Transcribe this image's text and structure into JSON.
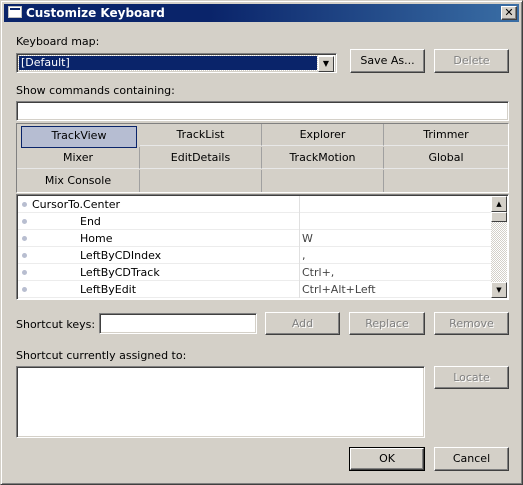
{
  "window": {
    "title": "Customize Keyboard",
    "close": "✕"
  },
  "keyboard_map": {
    "label": "Keyboard map:",
    "value": "[Default]",
    "save_as": "Save As...",
    "delete": "Delete"
  },
  "filter": {
    "label": "Show commands containing:",
    "value": ""
  },
  "tabs": [
    {
      "label": "TrackView",
      "selected": true
    },
    {
      "label": "TrackList"
    },
    {
      "label": "Explorer"
    },
    {
      "label": "Trimmer"
    },
    {
      "label": "Mixer"
    },
    {
      "label": "EditDetails"
    },
    {
      "label": "TrackMotion"
    },
    {
      "label": "Global"
    },
    {
      "label": "Mix Console"
    }
  ],
  "commands": [
    {
      "name": "CursorTo.Center",
      "key": ""
    },
    {
      "name": "End",
      "key": ""
    },
    {
      "name": "Home",
      "key": "W"
    },
    {
      "name": "LeftByCDIndex",
      "key": ","
    },
    {
      "name": "LeftByCDTrack",
      "key": "Ctrl+,"
    },
    {
      "name": "LeftByEdit",
      "key": "Ctrl+Alt+Left"
    }
  ],
  "shortcut": {
    "label": "Shortcut keys:",
    "value": "",
    "add": "Add",
    "replace": "Replace",
    "remove": "Remove"
  },
  "assigned": {
    "label": "Shortcut currently assigned to:",
    "locate": "Locate"
  },
  "footer": {
    "ok": "OK",
    "cancel": "Cancel"
  },
  "scroll": {
    "up": "▲",
    "down": "▼"
  },
  "combo_arrow": "▼"
}
